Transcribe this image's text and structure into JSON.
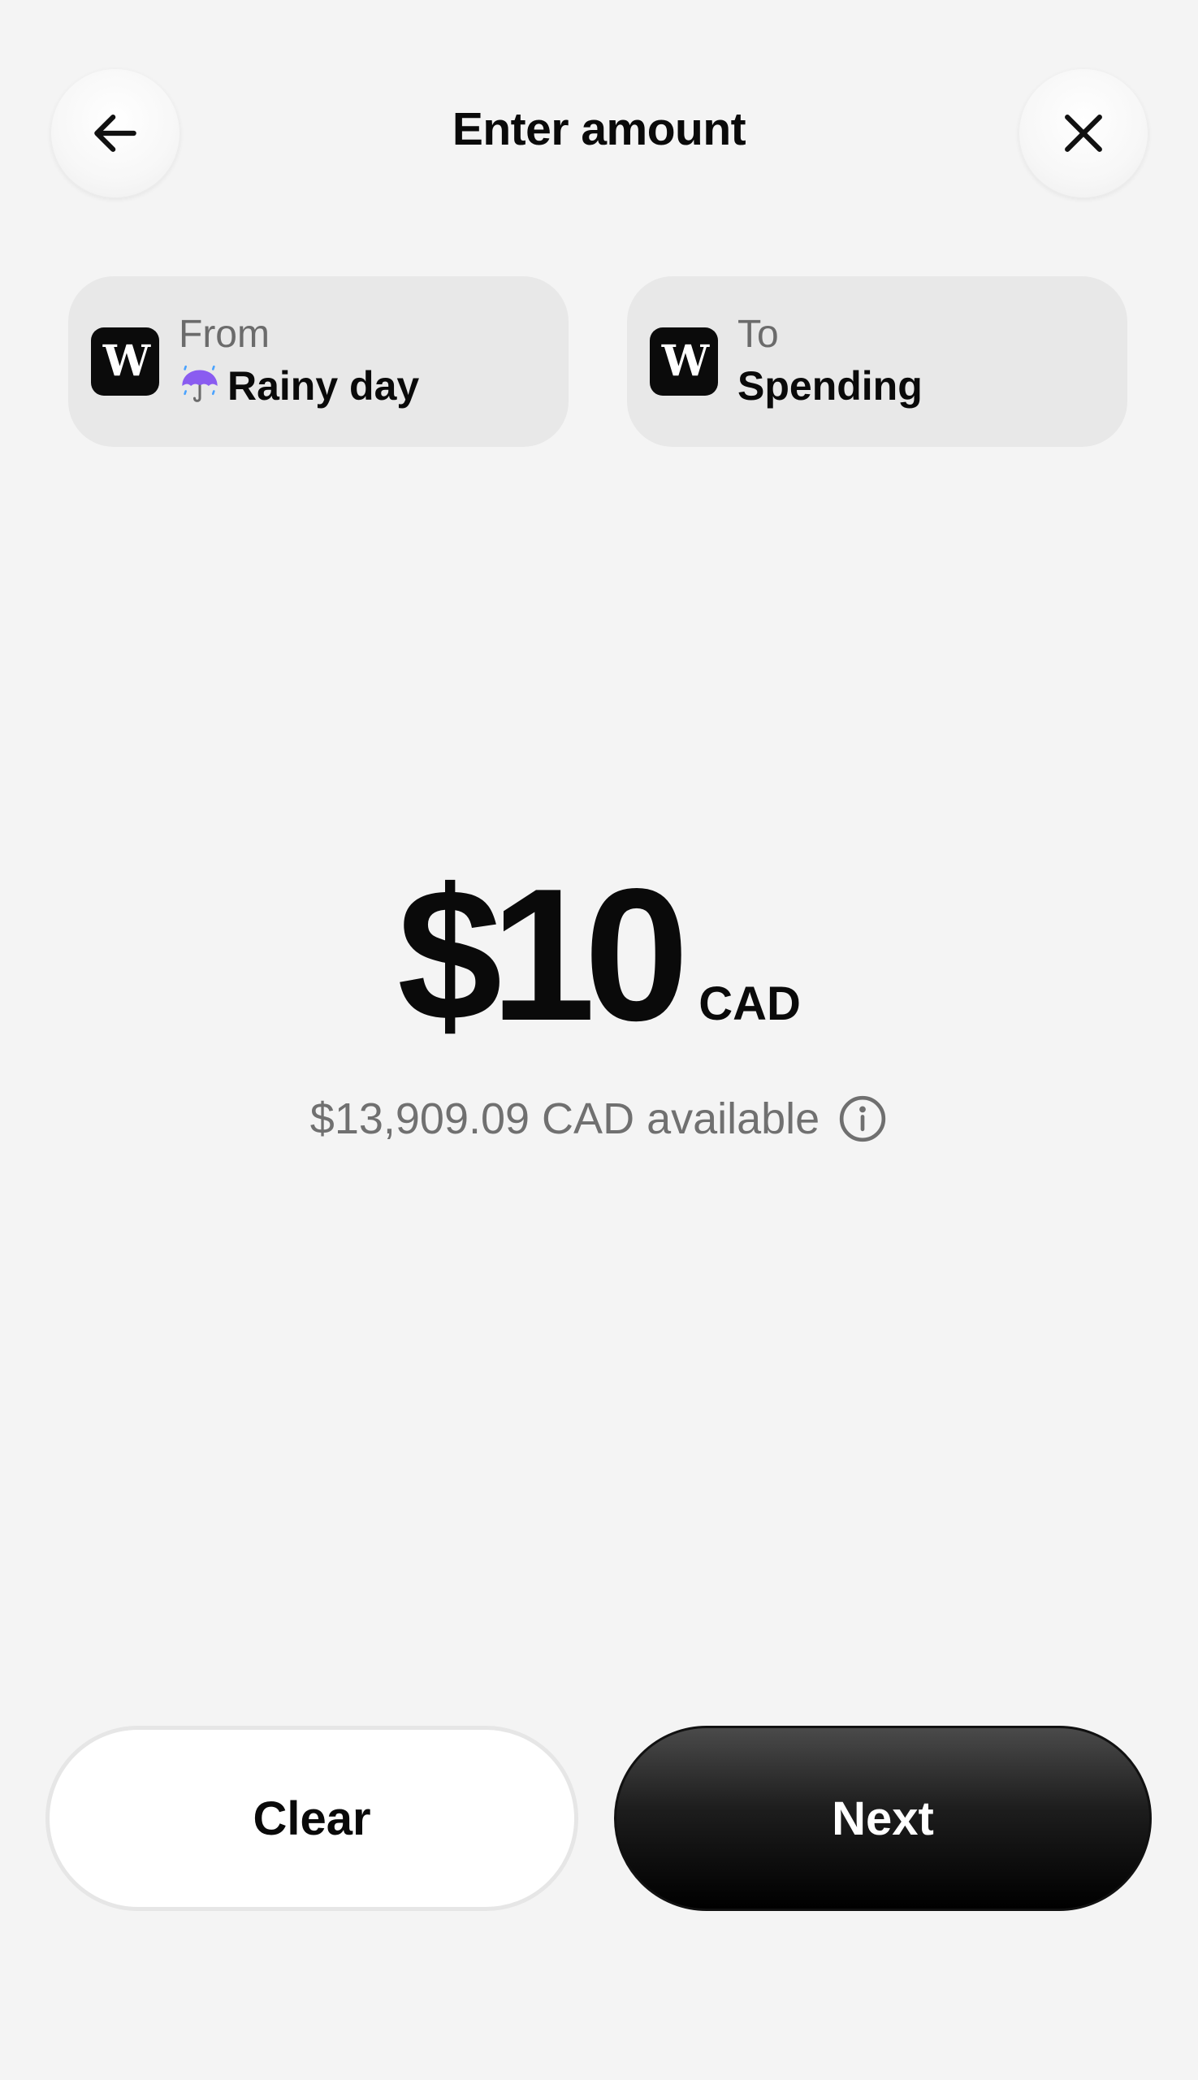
{
  "header": {
    "title": "Enter amount",
    "back_icon": "arrow-left-icon",
    "close_icon": "close-icon"
  },
  "accounts": {
    "from": {
      "caption": "From",
      "emoji": "☔",
      "name": "Rainy day",
      "logo_text": "W"
    },
    "to": {
      "caption": "To",
      "name": "Spending",
      "logo_text": "W"
    }
  },
  "amount": {
    "value": "$10",
    "currency": "CAD",
    "available": "$13,909.09 CAD available",
    "info_icon": "info-icon"
  },
  "actions": {
    "clear_label": "Clear",
    "next_label": "Next"
  },
  "colors": {
    "background": "#f4f4f4",
    "card": "#e8e8e8",
    "primary_button": "#000000",
    "muted_text": "#707070"
  }
}
